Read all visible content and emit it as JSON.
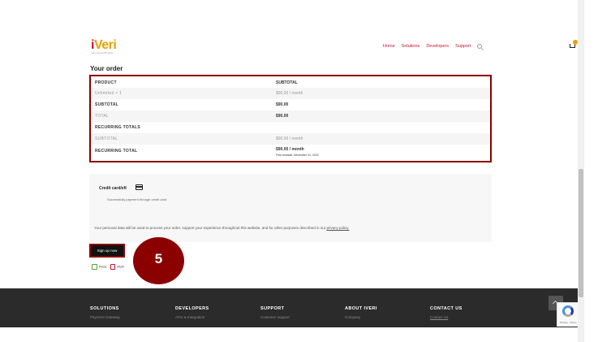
{
  "header": {
    "logo_text_i": "i",
    "logo_text_rest": "Veri",
    "logo_tagline": "payment technology",
    "nav": [
      "Home",
      "Solutions",
      "Developers",
      "Support"
    ]
  },
  "order": {
    "title": "Your order",
    "rows": [
      {
        "c1": "PRODUCT",
        "c2": "SUBTOTAL"
      },
      {
        "c1": "Unlimited × 1",
        "c2": "$90.00 / month"
      },
      {
        "c1": "SUBTOTAL",
        "c2": "$90.00"
      },
      {
        "c1": "TOTAL",
        "c2": "$90.00"
      },
      {
        "c1": "RECURRING TOTALS",
        "c2": ""
      },
      {
        "c1": "SUBTOTAL",
        "c2": "$90.00 / month"
      },
      {
        "c1": "RECURRING TOTAL",
        "c2": "$90.00 / month",
        "note": "First renewal: December 21, 2022"
      }
    ]
  },
  "payment": {
    "label": "Credit card/eft",
    "description": "Successfully payment through credit card",
    "privacy_text": "Your personal data will be used to process your order, support your experience throughout this website, and for other purposes described in our",
    "privacy_link": "privacy policy."
  },
  "signup": {
    "label": "Sign up now"
  },
  "print": {
    "print_label": "Print",
    "pdf_label": "PDF"
  },
  "step_marker": "5",
  "footer": {
    "columns": [
      {
        "heading": "SOLUTIONS",
        "link": "Payment Gateway"
      },
      {
        "heading": "DEVELOPERS",
        "link": "APIs & Integration"
      },
      {
        "heading": "SUPPORT",
        "link": "Customer support"
      },
      {
        "heading": "ABOUT IVERI",
        "link": "Company"
      },
      {
        "heading": "CONTACT US",
        "link": "Contact Us"
      }
    ]
  },
  "recaptcha": {
    "text": "Privacy - Terms"
  },
  "colors": {
    "brand_red": "#c8102e",
    "highlight_border": "#8b0000",
    "logo_gold": "#e8a200",
    "footer_bg": "#2b2b2b"
  }
}
